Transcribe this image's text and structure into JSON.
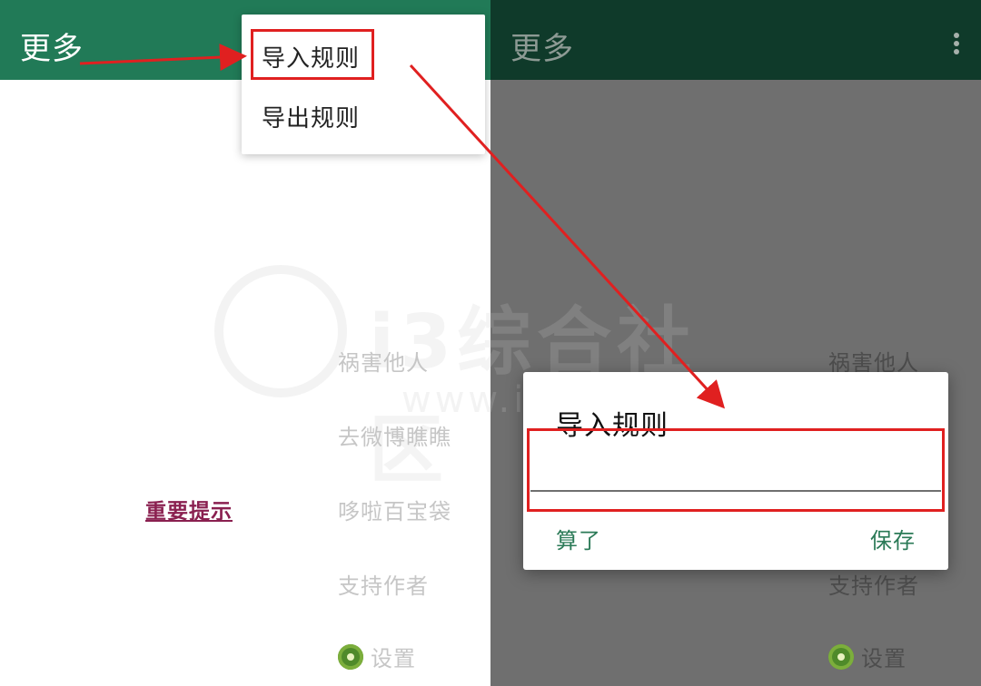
{
  "left_screen": {
    "appbar_title": "更多",
    "menu": [
      "导入规则",
      "导出规则"
    ],
    "list_items": [
      "祸害他人",
      "去微博瞧瞧",
      "哆啦百宝袋",
      "支持作者"
    ],
    "settings_label": "设置",
    "settings_icon": "kiwi-icon",
    "notice_link": "重要提示"
  },
  "right_screen": {
    "appbar_title": "更多",
    "overflow_icon": "more-vert-icon",
    "list_items": [
      "祸害他人",
      "支持作者"
    ],
    "settings_label": "设置",
    "dialog": {
      "title": "导入规则",
      "input_value": "",
      "cancel_label": "算了",
      "save_label": "保存"
    }
  },
  "watermark": {
    "line1": "i3综合社区",
    "line2": "www.i3zh.com"
  },
  "colors": {
    "appbar_left": "#217a57",
    "appbar_right": "#0f3a2a",
    "dialog_button": "#2b7a57",
    "annotation": "#e02020",
    "notice_link": "#8a2050"
  }
}
